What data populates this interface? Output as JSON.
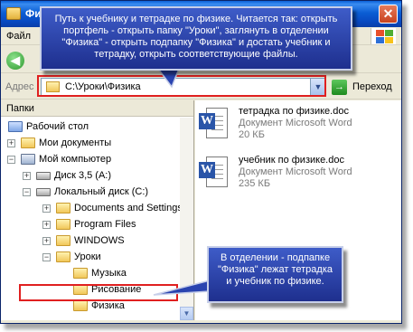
{
  "window": {
    "title": "Фи",
    "close_symbol": "✕"
  },
  "menu": {
    "file": "Файл"
  },
  "toolbar": {
    "back_symbol": "◀"
  },
  "address": {
    "label": "Адрес",
    "path": "C:\\Уроки\\Физика",
    "go_label": "Переход",
    "dropdown_symbol": "▼"
  },
  "folder_pane": {
    "header": "Папки",
    "tree": [
      {
        "label": "Рабочий стол",
        "icon": "desktop-icon",
        "expander": ""
      },
      {
        "label": "Мои документы",
        "icon": "folder-icon",
        "expander": "+"
      },
      {
        "label": "Мой компьютер",
        "icon": "computer-icon",
        "expander": "−"
      },
      {
        "label": "Диск 3,5 (A:)",
        "icon": "floppy-icon",
        "expander": "+"
      },
      {
        "label": "Локальный диск (C:)",
        "icon": "disk-icon",
        "expander": "−"
      },
      {
        "label": "Documents and Settings",
        "icon": "folder-icon",
        "expander": "+"
      },
      {
        "label": "Program Files",
        "icon": "folder-icon",
        "expander": "+"
      },
      {
        "label": "WINDOWS",
        "icon": "folder-icon",
        "expander": "+"
      },
      {
        "label": "Уроки",
        "icon": "folder-icon",
        "expander": "−"
      },
      {
        "label": "Музыка",
        "icon": "folder-icon",
        "expander": ""
      },
      {
        "label": "Рисование",
        "icon": "folder-icon",
        "expander": ""
      },
      {
        "label": "Физика",
        "icon": "folder-icon",
        "expander": ""
      }
    ],
    "scroll_down_symbol": "▼"
  },
  "files": [
    {
      "name": "тетрадка по физике.doc",
      "type": "Документ Microsoft Word",
      "size": "20 КБ",
      "icon": "word-document-icon"
    },
    {
      "name": "учебник по физике.doc",
      "type": "Документ Microsoft Word",
      "size": "235 КБ",
      "icon": "word-document-icon"
    }
  ],
  "callouts": {
    "top": "Путь к учебнику и тетрадке по физике. Читается так: открыть портфель - открыть папку \"Уроки\", заглянуть в отделении \"Физика\" - открыть подпапку \"Физика\" и достать учебник и тетрадку, открыть соответствующие файлы.",
    "bottom": "В отделении - подпапке \"Физика\" лежат тетрадка и учебник по физике."
  },
  "colors": {
    "callout_fill": "#2a44b0",
    "highlight": "#e02020",
    "titlebar": "#0b5ed4"
  }
}
